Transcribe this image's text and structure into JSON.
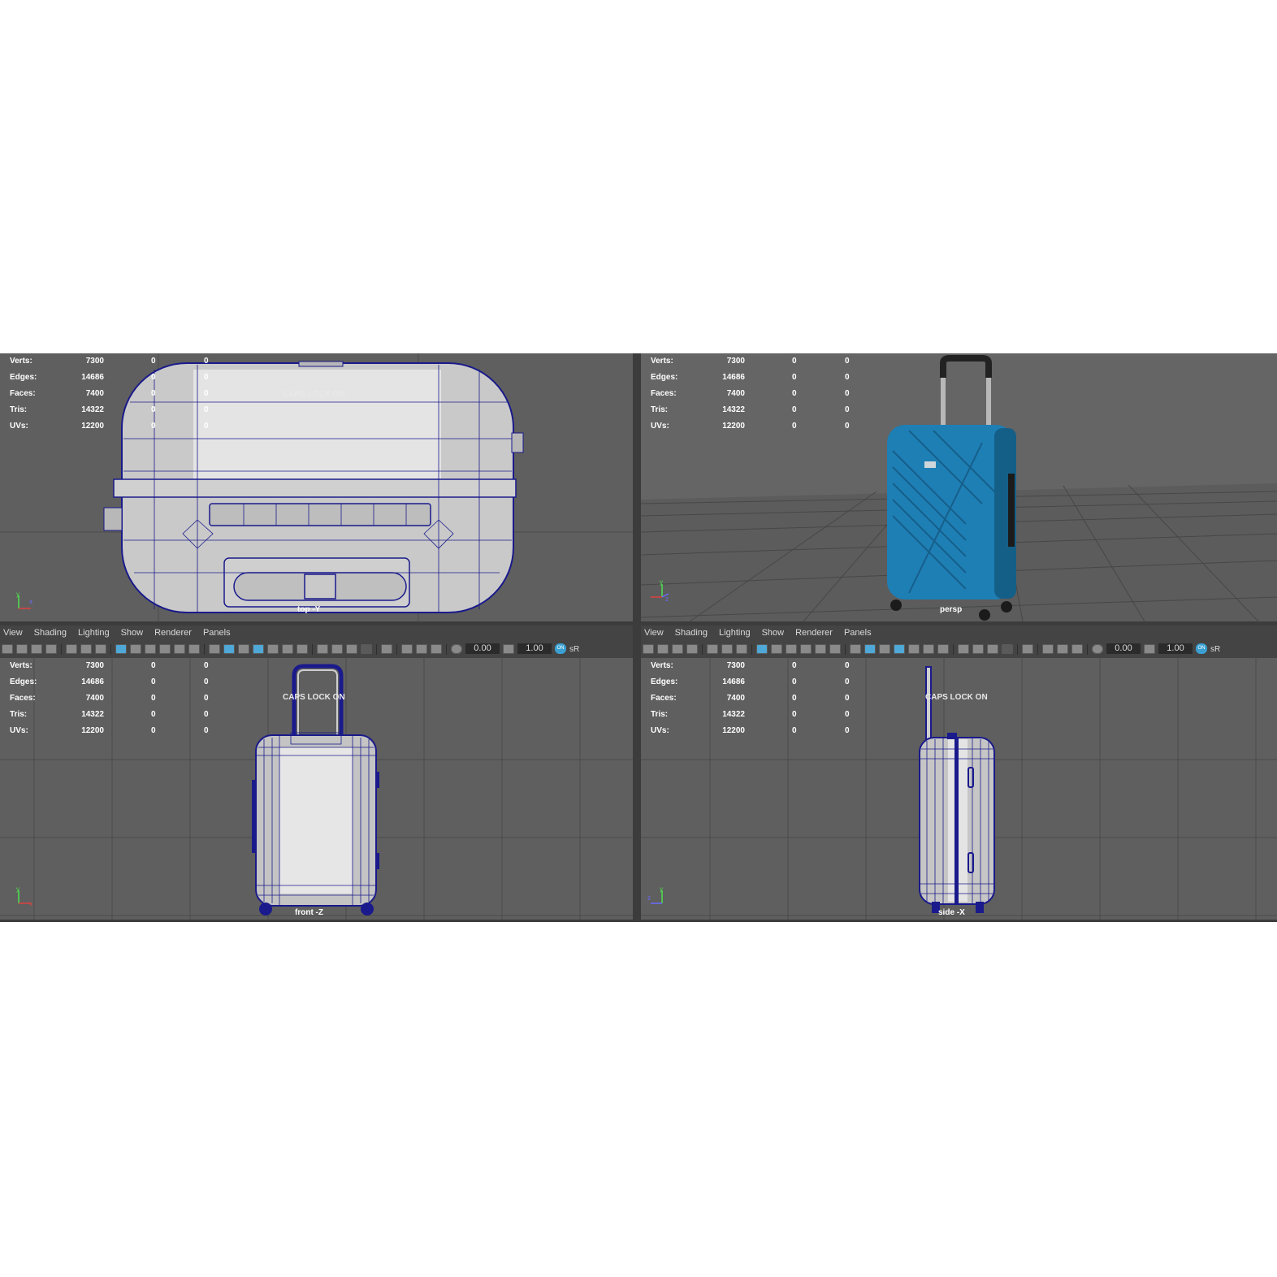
{
  "menus": [
    "View",
    "Shading",
    "Lighting",
    "Show",
    "Renderer",
    "Panels"
  ],
  "toolbar": {
    "exposure": "0.00",
    "gamma": "1.00",
    "color_mgmt": "ON",
    "color_space": "sR"
  },
  "hud": {
    "labels": [
      "Verts:",
      "Edges:",
      "Faces:",
      "Tris:",
      "UVs:"
    ],
    "values": [
      "7300",
      "14686",
      "7400",
      "14322",
      "12200"
    ],
    "zero": "0"
  },
  "caps_lock": "CAPS LOCK ON",
  "viewports": {
    "top": {
      "camera": "top -Y"
    },
    "persp": {
      "camera": "persp"
    },
    "front": {
      "camera": "front -Z"
    },
    "side": {
      "camera": "side -X"
    }
  },
  "colors": {
    "viewport_bg": "#5f5f5f",
    "grid": "#4a4a4a",
    "wire": "#1a1a8c",
    "suitcase_blue": "#1e7fb5",
    "highlight_icon": "#4fa9d8"
  },
  "icons": [
    "camera-icon",
    "grid-icon",
    "wireframe-icon",
    "smooth-shade-icon",
    "textured-icon",
    "light-icon",
    "isolate-icon",
    "exposure-icon",
    "gamma-icon"
  ]
}
